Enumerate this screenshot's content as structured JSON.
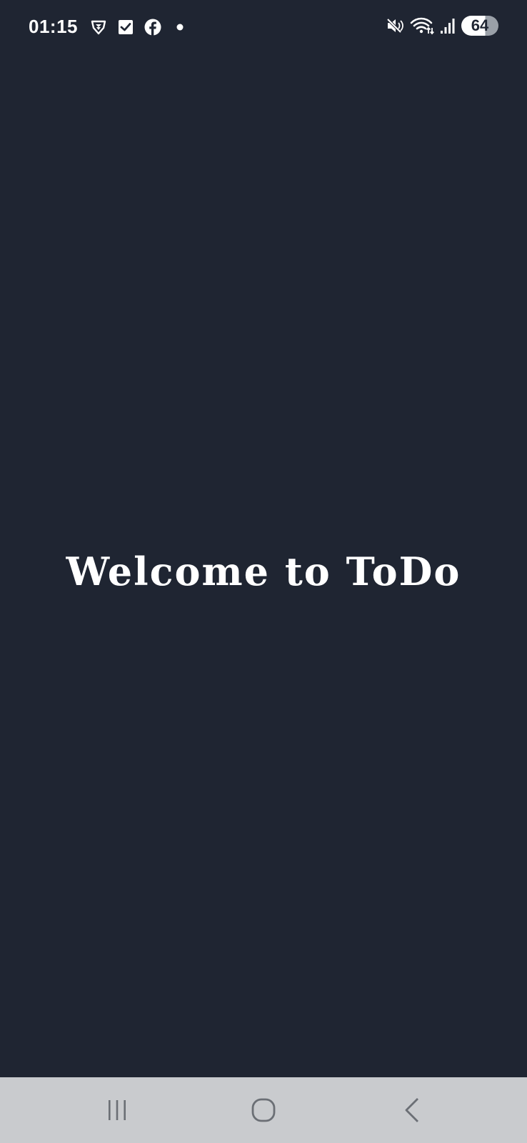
{
  "status_bar": {
    "time": "01:15",
    "battery_level": "64",
    "notification_icons": [
      "shield-icon",
      "check-box-icon",
      "facebook-icon",
      "dot-icon"
    ],
    "system_icons": [
      "mute-icon",
      "wifi-icon",
      "signal-icon",
      "battery-icon"
    ]
  },
  "main": {
    "welcome_text": "Welcome to ToDo"
  },
  "nav_bar": {
    "buttons": [
      "recents-button",
      "home-button",
      "back-button"
    ]
  },
  "colors": {
    "background": "#1f2532",
    "text": "#ffffff",
    "nav_bar": "#c9cbce",
    "nav_icon": "#6b6f75"
  }
}
